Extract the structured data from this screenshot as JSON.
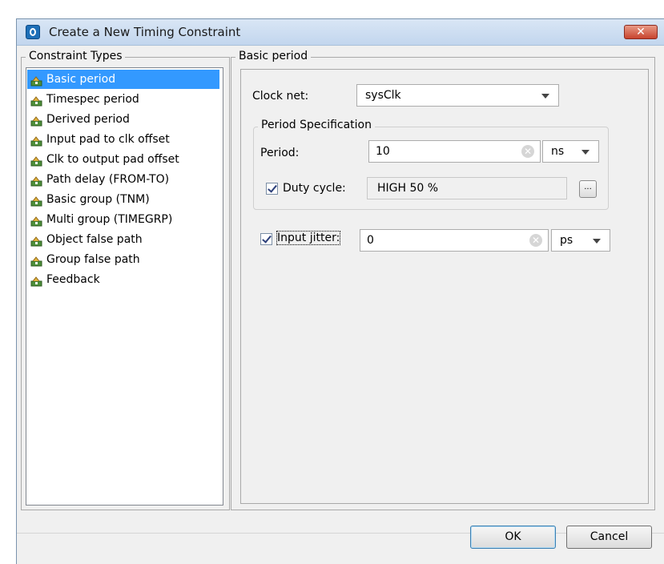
{
  "window": {
    "title": "Create a New Timing Constraint",
    "close_label": "✕"
  },
  "left_panel": {
    "legend": "Constraint Types",
    "items": [
      {
        "label": "Basic period",
        "selected": true
      },
      {
        "label": "Timespec period"
      },
      {
        "label": "Derived period"
      },
      {
        "label": "Input pad to clk offset"
      },
      {
        "label": "Clk to output pad offset"
      },
      {
        "label": "Path delay (FROM-TO)"
      },
      {
        "label": "Basic group (TNM)"
      },
      {
        "label": "Multi group (TIMEGRP)"
      },
      {
        "label": "Object false path"
      },
      {
        "label": "Group false path"
      },
      {
        "label": "Feedback"
      }
    ]
  },
  "right_panel": {
    "legend": "Basic period",
    "clock_net": {
      "label": "Clock net:",
      "value": "sysClk"
    },
    "period_spec": {
      "legend": "Period Specification",
      "period": {
        "label": "Period:",
        "value": "10",
        "unit": "ns"
      },
      "duty_cycle": {
        "label": "Duty cycle:",
        "checked": true,
        "value": "HIGH 50 %",
        "button_label": "..."
      }
    },
    "input_jitter": {
      "label": "Input jitter:",
      "checked": true,
      "value": "0",
      "unit": "ps"
    }
  },
  "footer": {
    "ok_label": "OK",
    "cancel_label": "Cancel"
  },
  "colors": {
    "selection": "#3399ff",
    "window_bg": "#f0f0f0",
    "titlebar": "#c2d6ee",
    "close_button": "#c8442e"
  }
}
